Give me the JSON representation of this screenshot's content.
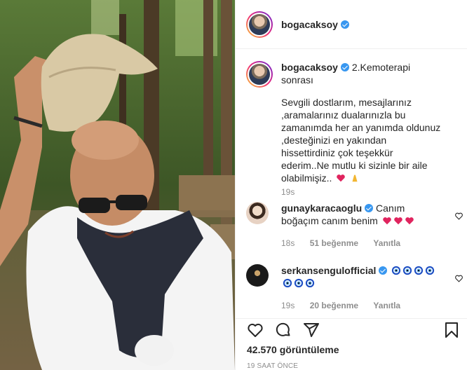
{
  "post": {
    "username": "bogacaksoy",
    "caption_title": "2.Kemoterapi sonrası",
    "caption_body": "Sevgili dostlarım, mesajlarınız ,aramalarınız dualarınızla bu zamanımda her an yanımda oldunuz ,desteğinizi en yakından hissettirdiniz çok teşekkür ederim..Ne mutlu ki sizinle bir aile olabilmişiz..",
    "caption_emojis": [
      "red-heart",
      "folded-hands"
    ],
    "caption_time": "19s"
  },
  "comments": [
    {
      "username": "gunaykaracaoglu",
      "text": "Canım boğaçım canım benim",
      "emojis": [
        "red-heart",
        "red-heart",
        "red-heart"
      ],
      "time": "18s",
      "likes": "51 beğenme",
      "reply": "Yanıtla"
    },
    {
      "username": "serkansengulofficial",
      "text": "",
      "emojis": [
        "nazar-amulet",
        "nazar-amulet",
        "nazar-amulet",
        "nazar-amulet",
        "nazar-amulet",
        "nazar-amulet",
        "nazar-amulet"
      ],
      "time": "19s",
      "likes": "20 beğenme",
      "reply": "Yanıtla"
    }
  ],
  "actions": {
    "icons": [
      "heart-icon",
      "comment-icon",
      "share-icon",
      "bookmark-icon"
    ],
    "views": "42.570 görüntüleme",
    "posted_ago": "19 SAAT ÖNCE"
  },
  "colors": {
    "verified_blue": "#3897f0",
    "emoji_red": "#e0245e",
    "muted_text": "#8e8e8e"
  }
}
